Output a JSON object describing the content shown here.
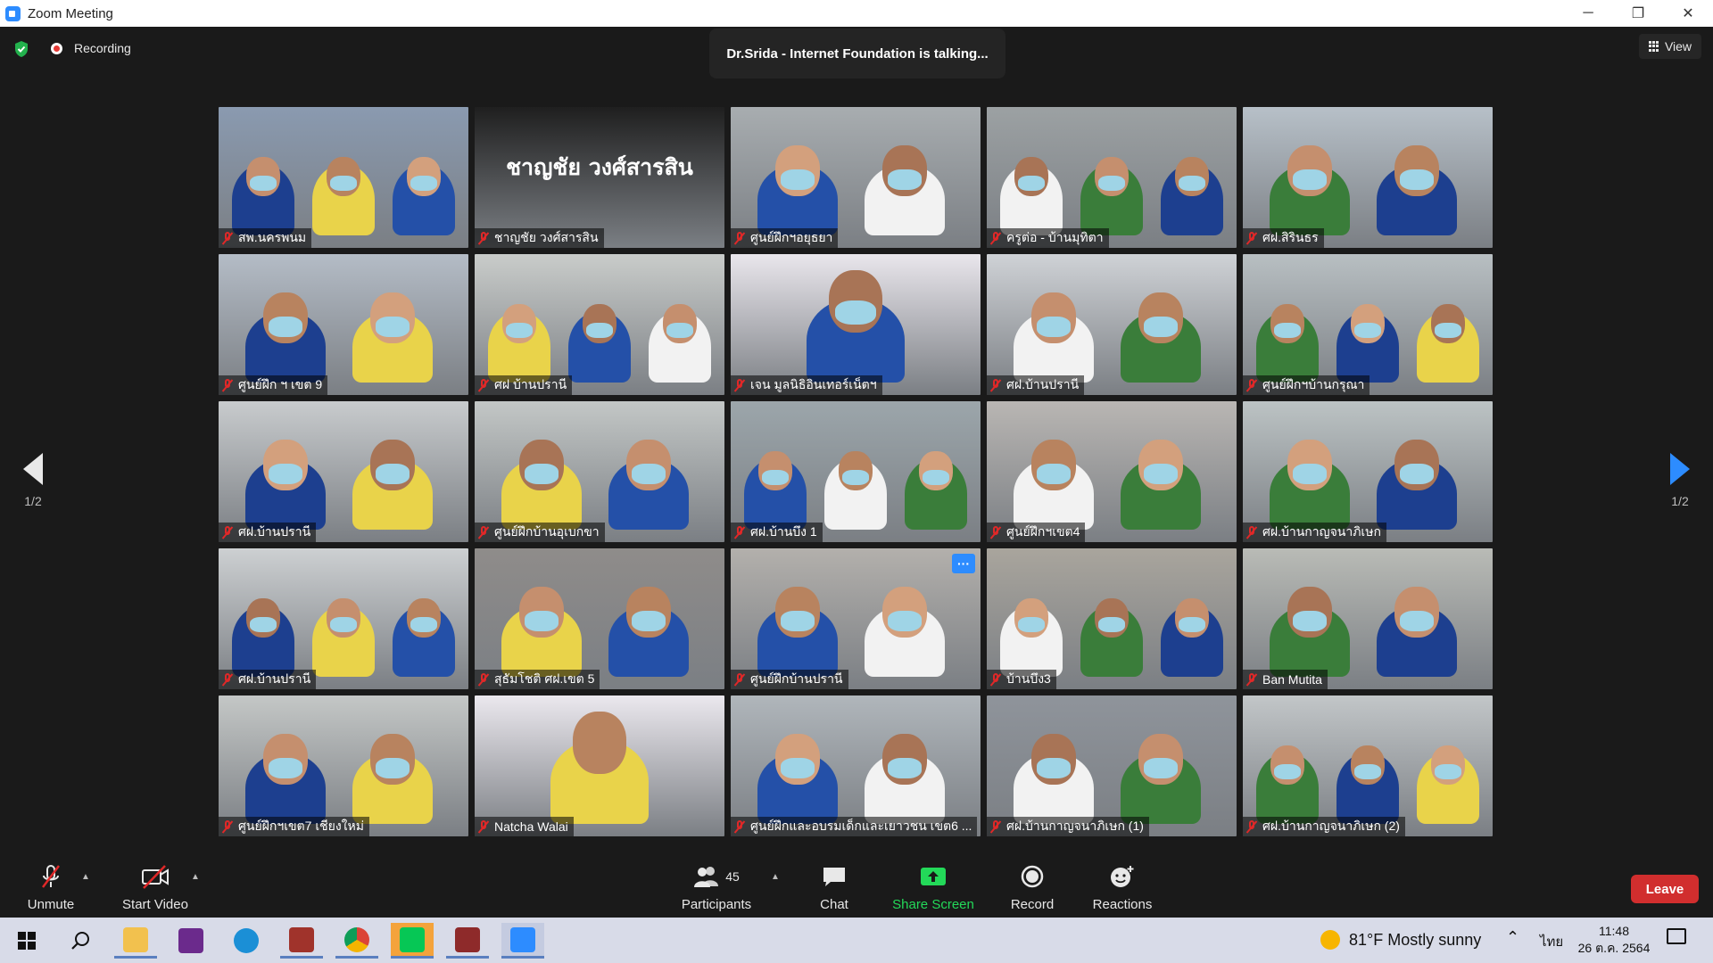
{
  "window": {
    "title": "Zoom Meeting",
    "minimize": "─",
    "restore": "❐",
    "close": "✕"
  },
  "topbar": {
    "recording_label": "Recording",
    "talking_text": "Dr.Srida - Internet Foundation is talking...",
    "view_label": "View"
  },
  "tiles": [
    {
      "label": "สพ.นครพนม",
      "bg": "#8a9ab0"
    },
    {
      "label": "ชาญชัย วงศ์สารสิน",
      "bg": "#1f1f1f",
      "display_name": "ชาญชัย วงศ์สารสิน"
    },
    {
      "label": "ศูนย์ฝึกฯอยุธยา",
      "bg": "#a8adb0"
    },
    {
      "label": "ครูต่อ - บ้านมุทิตา",
      "bg": "#9ca1a3"
    },
    {
      "label": "ศฝ.สิรินธร",
      "bg": "#b7c0c8"
    },
    {
      "label": "ศูนย์ฝึก ฯ เขต 9",
      "bg": "#b4bcc6"
    },
    {
      "label": "ศฝ บ้านปรานี",
      "bg": "#c9ccca"
    },
    {
      "label": "เจน มูลนิธิอินเทอร์เน็ตฯ",
      "bg": "#e9e6ec"
    },
    {
      "label": "ศฝ.บ้านปรานี",
      "bg": "#cfd2d6"
    },
    {
      "label": "ศูนย์ฝึกฯบ้านกรุณา",
      "bg": "#b8bfc2"
    },
    {
      "label": "ศฝ.บ้านปรานี",
      "bg": "#c8cbcd"
    },
    {
      "label": "ศูนย์ฝึกบ้านอุเบกขา",
      "bg": "#c3c7c6"
    },
    {
      "label": "ศฝ.บ้านบึง 1",
      "bg": "#9ca6ab"
    },
    {
      "label": "ศูนย์ฝึกฯเขต4",
      "bg": "#b9b6b3"
    },
    {
      "label": "ศฝ.บ้านกาญจนาภิเษก",
      "bg": "#bcc3c4"
    },
    {
      "label": "ศฝ.บ้านปรานี",
      "bg": "#cdd0d2"
    },
    {
      "label": "สุธัมโชติ ศฝ.เขต 5",
      "bg": "#8f8c8a"
    },
    {
      "label": "ศูนย์ฝึกบ้านปรานี",
      "bg": "#b3b0ac"
    },
    {
      "label": "บ้านบึง3",
      "bg": "#a9a59d"
    },
    {
      "label": "Ban Mutita",
      "bg": "#b9bbb6"
    },
    {
      "label": "ศูนย์ฝึกฯเขต7 เชียงใหม่",
      "bg": "#c4c7c6"
    },
    {
      "label": "Natcha Walai",
      "bg": "#ebe8ee"
    },
    {
      "label": "ศูนย์ฝึกและอบรมเด็กและเยาวชน เขต6 ...",
      "bg": "#b0b6bb"
    },
    {
      "label": "ศฝ.บ้านกาญจนาภิเษก (1)",
      "bg": "#8f949b"
    },
    {
      "label": "ศฝ.บ้านกาญจนาภิเษก (2)",
      "bg": "#c2c6c8"
    }
  ],
  "paging": {
    "left": "1/2",
    "right": "1/2"
  },
  "toolbar": {
    "unmute": "Unmute",
    "start_video": "Start Video",
    "participants": "Participants",
    "participants_count": "45",
    "chat": "Chat",
    "share_screen": "Share Screen",
    "record": "Record",
    "reactions": "Reactions",
    "leave": "Leave"
  },
  "colors": {
    "accent": "#2d8cff",
    "share_green": "#23d959",
    "leave_red": "#d12e2e",
    "mic_red": "#e02828"
  },
  "taskbar": {
    "icons": [
      "windows-start-icon",
      "search-icon",
      "file-explorer-icon",
      "pdf-app-icon",
      "edge-icon",
      "photo-app-icon",
      "chrome-icon",
      "line-icon",
      "photo-app-icon-2",
      "zoom-icon"
    ],
    "weather": "81°F  Mostly sunny",
    "language": "ไทย",
    "time": "11:48",
    "date": "26 ต.ค. 2564"
  }
}
